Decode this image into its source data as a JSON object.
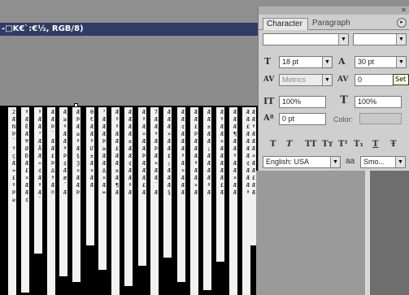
{
  "document": {
    "title": "-□K€`:€½, RGB/8)"
  },
  "canvas": {
    "strips": [
      "2ÆNÞ¨ªçÆ≈£ªÞ≥",
      "ªÆËÆ¥ØÐÆ£¤ÆÆ¢",
      "ªÆÆ³ÆÅÆ«¢ÆªÆ¨",
      "ÆÆÞ¨ÆÆ£Þ∆ªÆ©",
      "Æ≥ªÆÆªÞ¢Ææ¨Æ",
      "ÆÞÆ≥ªÆ§Ȝ¤ÆÆÞ",
      "Ɵ€ÆÆªƯ±Æ¤ÆÆ",
      "³ÆÆÆÞ≥ÆÆ∆¤Æ∞",
      "ÆªªÆÆ£ÆÆ±Æ¶Æ",
      "ÆÆÆÆ±ÆÆ¢ÆÆªÆ",
      "ÆªÆ¤ÆÆÞÆÆÆ£Æ",
      "7ÆÆªÆÞÆ¤ÆÆ¨Æ",
      "ÆÆÆ¤ÆÆ£¡ÆÆÆ§",
      "ÆÆ¢ÆÆÆªÆ¤ÆÆÆ",
      "ÆÆ£ÞÆÆÆªÆÆ¤Æ",
      "ÆÆ±ÆÆ¡ÆÆÆÆªÆ",
      "ÆªÆÆ¤ÆÆÆÆÆ£Æ",
      "ÆÆÆ¶ÆÆªÆÆ¤ÆÆ",
      "ÆÆ£ÆÆÆÆ¢ÆÆÆª",
      "ÆÆªÆÆÆ¤ÆÆ£ÆÆ",
      "ÆÆÆÆªÆÆ¤ÆÆÆ£"
    ]
  },
  "panel": {
    "tabs": [
      "Character",
      "Paragraph"
    ],
    "font_family": "",
    "font_style": "",
    "font_size": "18 pt",
    "leading": "30 pt",
    "kerning": "Metrics",
    "tracking": "0",
    "tooltip": "Set tracking",
    "vertical_scale": "100%",
    "horizontal_scale": "100%",
    "baseline_shift": "0 pt",
    "color_label": "Color:",
    "style_buttons": [
      "T",
      "T",
      "TT",
      "Tт",
      "T¹",
      "T₁",
      "T",
      "Ŧ"
    ],
    "language": "English: USA",
    "antialias_icon": "aa",
    "antialias": "Smo..."
  },
  "colors": {
    "title_bar": "#2f3c63",
    "panel_bg": "#cfcfcf",
    "canvas_bg": "#000000"
  }
}
